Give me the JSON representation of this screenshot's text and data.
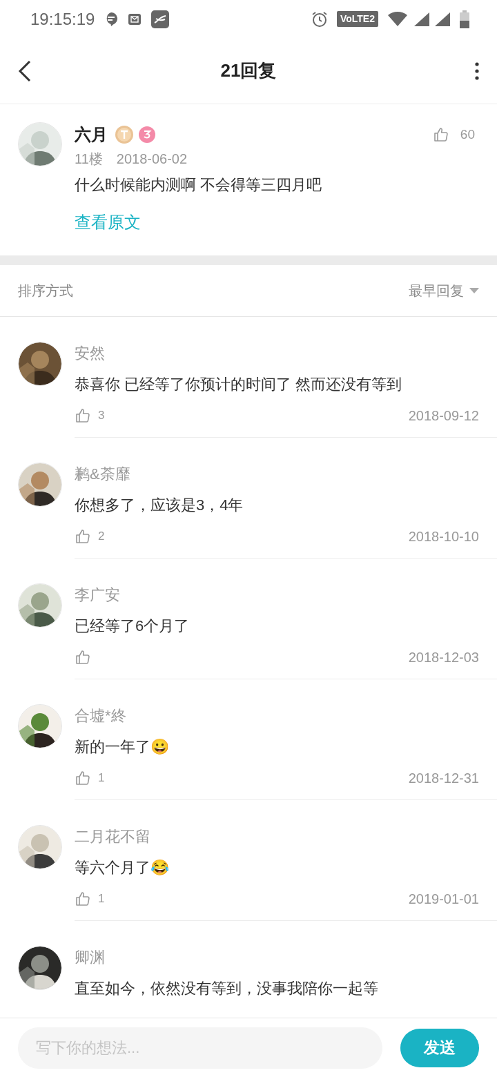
{
  "status_bar": {
    "time": "19:15:19",
    "volte": "VoLTE2"
  },
  "header": {
    "title": "21回复"
  },
  "post": {
    "author": "六月",
    "floor": "11楼",
    "date": "2018-06-02",
    "likes": "60",
    "text": "什么时候能内测啊 不会得等三四月吧",
    "view_original": "查看原文"
  },
  "sort": {
    "label": "排序方式",
    "value": "最早回复"
  },
  "replies": [
    {
      "author": "安然",
      "text": "恭喜你 已经等了你预计的时间了 然而还没有等到",
      "likes": "3",
      "date": "2018-09-12"
    },
    {
      "author": "鹣&荼靡",
      "text": "你想多了，应该是3，4年",
      "likes": "2",
      "date": "2018-10-10"
    },
    {
      "author": "李广安",
      "text": "已经等了6个月了",
      "date": "2018-12-03"
    },
    {
      "author": "合墟*終",
      "text": "新的一年了😀",
      "likes": "1",
      "date": "2018-12-31"
    },
    {
      "author": "二月花不留",
      "text": "等六个月了😂",
      "likes": "1",
      "date": "2019-01-01"
    },
    {
      "author": "卿渊",
      "text": "直至如今，依然没有等到，没事我陪你一起等"
    }
  ],
  "composer": {
    "placeholder": "写下你的想法...",
    "send": "发送"
  }
}
